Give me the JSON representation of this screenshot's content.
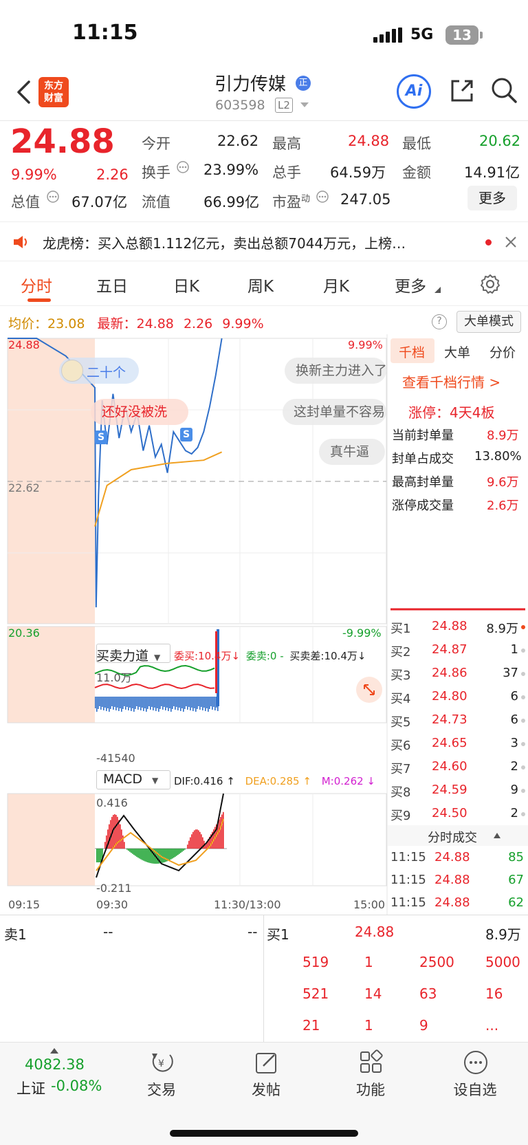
{
  "status_bar": {
    "time": "11:15",
    "network": "5G",
    "battery": "13"
  },
  "header": {
    "logo_line1": "东方",
    "logo_line2": "财富",
    "stock_name": "引力传媒",
    "badge": "正",
    "stock_code": "603598",
    "level": "L2",
    "ai_label": "Ai"
  },
  "quote": {
    "price": "24.88",
    "change_pct": "9.99%",
    "change": "2.26",
    "open_label": "今开",
    "open": "22.62",
    "high_label": "最高",
    "high": "24.88",
    "low_label": "最低",
    "low": "20.62",
    "turnover_label": "换手",
    "turnover": "23.99%",
    "volume_label": "总手",
    "volume": "64.59万",
    "amount_label": "金额",
    "amount": "14.91亿",
    "mktcap_label": "总值",
    "mktcap": "67.07亿",
    "float_label": "流值",
    "float": "66.99亿",
    "pe_label": "市盈",
    "pe_sup": "动",
    "pe": "247.05",
    "more_button": "更多"
  },
  "notice": {
    "text": "龙虎榜：买入总额1.112亿元，卖出总额7044万元，上榜…"
  },
  "tabs": [
    "分时",
    "五日",
    "日K",
    "周K",
    "月K",
    "更多"
  ],
  "legend": {
    "avg_label": "均价：",
    "avg": "23.08",
    "latest_label": "最新：",
    "latest": "24.88",
    "change": "2.26",
    "change_pct": "9.99%",
    "help": "?",
    "big_order_button": "大单模式"
  },
  "main_chart": {
    "y_top": "24.88",
    "y_mid": "22.62",
    "y_bottom": "20.36",
    "pct_top": "9.99%",
    "pct_bottom": "-9.99%",
    "marker": "S",
    "bubbles": [
      "二十个",
      "还好没被洗",
      "换新主力进入了",
      "这封单量不容易",
      "真牛逼"
    ]
  },
  "chart_data": {
    "type": "line",
    "title": "",
    "x_ticks": [
      "09:15",
      "09:30",
      "11:30/13:00",
      "15:00"
    ],
    "ylim": [
      20.36,
      24.88
    ],
    "prev_close": 22.62,
    "series": [
      {
        "name": "",
        "x": [
          "09:15",
          "09:20",
          "09:25",
          "09:30",
          "09:31",
          "09:33",
          "09:36",
          "09:40",
          "09:45",
          "09:50",
          "09:55",
          "10:00",
          "10:05",
          "10:10",
          "10:15",
          "10:20",
          "10:25",
          "10:30",
          "10:35",
          "10:40",
          "10:45",
          "10:50",
          "10:55",
          "11:00",
          "11:05",
          "11:10",
          "11:15"
        ],
        "values": [
          24.88,
          24.88,
          24.6,
          24.1,
          20.62,
          22.4,
          23.9,
          23.2,
          24.0,
          23.3,
          23.8,
          23.4,
          23.7,
          23.1,
          23.5,
          23.0,
          23.2,
          22.75,
          23.4,
          23.25,
          23.1,
          23.05,
          23.15,
          23.4,
          23.8,
          24.3,
          24.88
        ]
      },
      {
        "name": "均价",
        "x": [
          "09:30",
          "09:40",
          "10:00",
          "10:30",
          "11:00",
          "11:15"
        ],
        "values": [
          21.9,
          22.55,
          22.8,
          22.9,
          22.95,
          23.08
        ]
      }
    ]
  },
  "right_panel": {
    "tabs": [
      "千档",
      "大单",
      "分价"
    ],
    "link": "查看千档行情 >",
    "limit_up": "涨停：4天4板",
    "stats": [
      {
        "label": "当前封单量",
        "value": "8.9万"
      },
      {
        "label": "封单占成交",
        "value": "13.80%"
      },
      {
        "label": "最高封单量",
        "value": "9.6万"
      },
      {
        "label": "涨停成交量",
        "value": "2.6万"
      }
    ],
    "bids": [
      {
        "label": "买1",
        "price": "24.88",
        "vol": "8.9万"
      },
      {
        "label": "买2",
        "price": "24.87",
        "vol": "1"
      },
      {
        "label": "买3",
        "price": "24.86",
        "vol": "37"
      },
      {
        "label": "买4",
        "price": "24.80",
        "vol": "6"
      },
      {
        "label": "买5",
        "price": "24.73",
        "vol": "6"
      },
      {
        "label": "买6",
        "price": "24.65",
        "vol": "3"
      },
      {
        "label": "买7",
        "price": "24.60",
        "vol": "2"
      },
      {
        "label": "买8",
        "price": "24.59",
        "vol": "9"
      },
      {
        "label": "买9",
        "price": "24.50",
        "vol": "2"
      }
    ],
    "ticks_header": "分时成交",
    "ticks": [
      {
        "time": "11:15",
        "price": "24.88",
        "vol": "85"
      },
      {
        "time": "11:15",
        "price": "24.88",
        "vol": "67"
      },
      {
        "time": "11:15",
        "price": "24.88",
        "vol": "62"
      }
    ]
  },
  "power_chart": {
    "selector": "买卖力道",
    "commit_buy": "委买:10.4万",
    "commit_sell": "委卖:0",
    "dash": "-",
    "diff": "买卖差:10.4万",
    "y_top": "11.0万",
    "y_bottom": "-41540"
  },
  "macd": {
    "selector": "MACD",
    "dif": "DIF:0.416",
    "dea": "DEA:0.285",
    "m": "M:0.262",
    "y_top": "0.416",
    "y_bottom": "-0.211",
    "x_ticks": [
      "09:15",
      "09:30",
      "11:30/13:00",
      "15:00"
    ]
  },
  "orderbook": {
    "sell1_label": "卖1",
    "sell1_price": "--",
    "sell1_vol": "--",
    "buy1_label": "买1",
    "buy1_price": "24.88",
    "buy1_vol": "8.9万",
    "queue": [
      [
        "519",
        "1",
        "2500",
        "5000"
      ],
      [
        "521",
        "14",
        "63",
        "16"
      ],
      [
        "21",
        "1",
        "9",
        "..."
      ]
    ]
  },
  "bottom_nav": {
    "index_value": "4082.38",
    "index_name": "上证",
    "index_change": "-0.08%",
    "items": [
      "交易",
      "发帖",
      "功能",
      "设自选"
    ]
  }
}
